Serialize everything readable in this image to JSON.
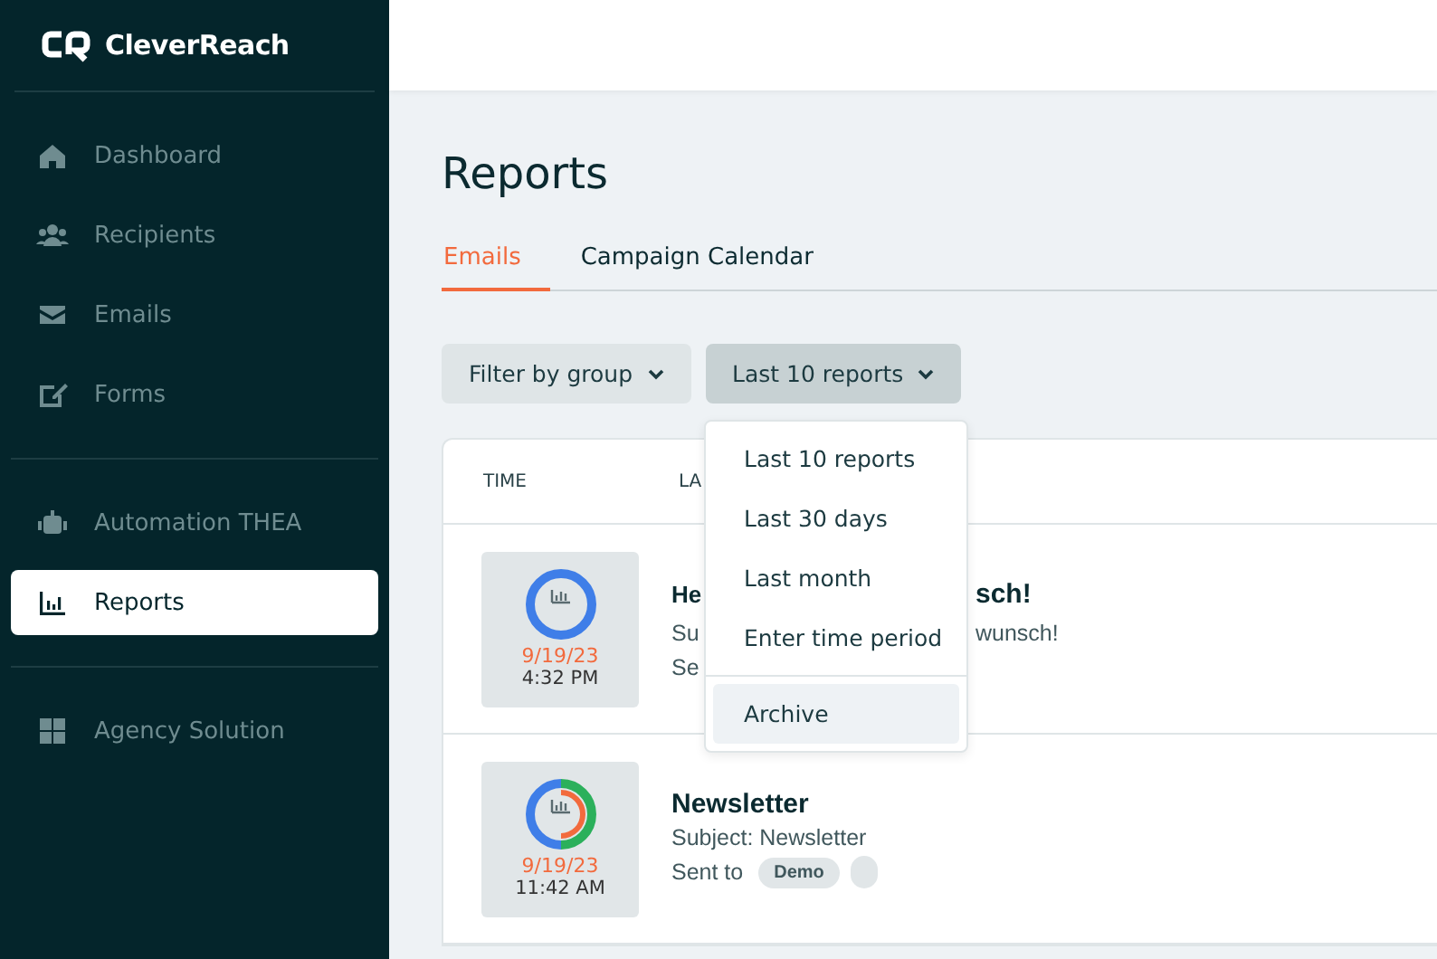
{
  "brand": {
    "name": "CleverReach"
  },
  "sidebar": {
    "groups": [
      [
        {
          "label": "Dashboard",
          "selected": false
        },
        {
          "label": "Recipients",
          "selected": false
        },
        {
          "label": "Emails",
          "selected": false
        },
        {
          "label": "Forms",
          "selected": false
        }
      ],
      [
        {
          "label": "Automation THEA",
          "selected": false
        },
        {
          "label": "Reports",
          "selected": true
        }
      ],
      [
        {
          "label": "Agency Solution",
          "selected": false
        }
      ]
    ]
  },
  "page": {
    "title": "Reports"
  },
  "tabs": [
    {
      "label": "Emails",
      "selected": true
    },
    {
      "label": "Campaign Calendar",
      "selected": false
    }
  ],
  "filters": [
    {
      "label": "Filter by group",
      "open": false
    },
    {
      "label": "Last 10 reports",
      "open": true
    }
  ],
  "dropdown": {
    "items": [
      {
        "label": "Last 10 reports",
        "selected": false
      },
      {
        "label": "Last 30 days",
        "selected": false
      },
      {
        "label": "Last month",
        "selected": false
      },
      {
        "label": "Enter time period",
        "selected": false
      },
      {
        "label": "Archive",
        "selected": true
      }
    ]
  },
  "table": {
    "columns": [
      "TIME",
      "LA"
    ],
    "rows": [
      {
        "kind": "plain",
        "date": "9/19/23",
        "time": "4:32 PM",
        "title_parts": [
          "He",
          "sch!"
        ],
        "subject_parts": [
          "Su",
          "wunsch!"
        ],
        "sent_parts": [
          "Se"
        ]
      },
      {
        "kind": "split",
        "date": "9/19/23",
        "time": "11:42 AM",
        "title_parts": [
          "Newsletter"
        ],
        "subject_parts": [
          "Subject: Newsletter"
        ],
        "sent_parts": [
          "Sent to"
        ],
        "tags": [
          "Demo"
        ],
        "partial_tag": true
      }
    ]
  }
}
